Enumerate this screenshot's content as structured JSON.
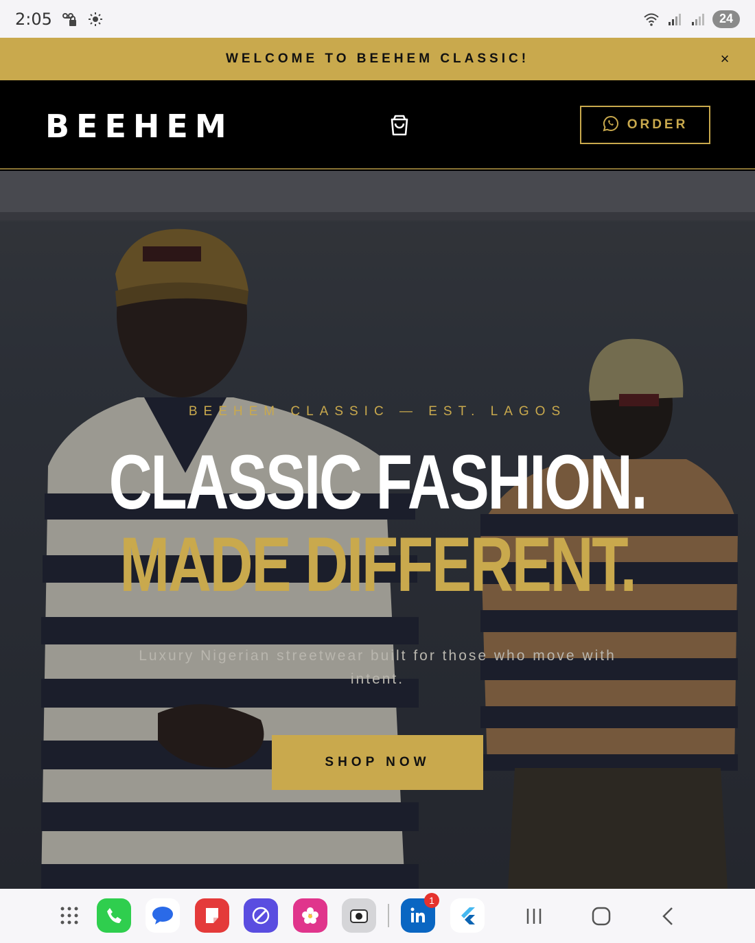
{
  "status_bar": {
    "time": "2:05",
    "battery": "24",
    "icons": [
      "voicemail-lock-icon",
      "brightness-icon",
      "wifi-icon",
      "signal-icon",
      "signal-icon"
    ]
  },
  "announcement": {
    "text": "WELCOME TO BEEHEM CLASSIC!",
    "close_label": "×"
  },
  "header": {
    "logo": "BEEHEM",
    "cart_icon": "shopping-bag-icon",
    "order_label": "ORDER",
    "order_icon": "whatsapp-icon"
  },
  "hero": {
    "eyebrow": "BEEHEM CLASSIC — EST. LAGOS",
    "headline_line1": "CLASSIC FASHION.",
    "headline_line2": "MADE DIFFERENT.",
    "subtitle": "Luxury Nigerian streetwear built for those who move with intent.",
    "cta_label": "SHOP NOW"
  },
  "dock": {
    "apps": [
      {
        "name": "app-drawer-icon"
      },
      {
        "name": "phone-app-icon"
      },
      {
        "name": "messages-app-icon"
      },
      {
        "name": "notes-app-icon"
      },
      {
        "name": "browser-app-icon"
      },
      {
        "name": "gallery-app-icon"
      },
      {
        "name": "camera-app-icon"
      },
      {
        "name": "linkedin-app-icon",
        "badge": "1"
      },
      {
        "name": "flutter-app-icon"
      }
    ],
    "nav": [
      "recents-icon",
      "home-icon",
      "back-icon"
    ]
  },
  "colors": {
    "gold": "#c9a94d",
    "black": "#000000",
    "white": "#ffffff"
  }
}
